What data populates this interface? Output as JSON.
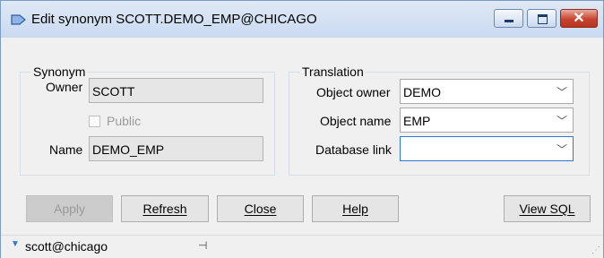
{
  "window": {
    "title": "Edit synonym SCOTT.DEMO_EMP@CHICAGO",
    "close_glyph": "✕",
    "icon": "synonym-arrow-icon",
    "accent_color": "#2a7ad6"
  },
  "synonym": {
    "legend": "Synonym",
    "owner_label": "Owner",
    "owner_value": "SCOTT",
    "public_label": "Public",
    "public_checked": false,
    "name_label": "Name",
    "name_value": "DEMO_EMP"
  },
  "translation": {
    "legend": "Translation",
    "object_owner_label": "Object owner",
    "object_owner_value": "DEMO",
    "object_name_label": "Object name",
    "object_name_value": "EMP",
    "database_link_label": "Database link",
    "database_link_value": ""
  },
  "buttons": {
    "apply": "Apply",
    "refresh": "Refresh",
    "close": "Close",
    "help": "Help",
    "view_sql": "View SQL"
  },
  "status": {
    "connection": "scott@chicago"
  },
  "glyphs": {
    "chevron": "﹀",
    "dropdown_arrow": "▼",
    "pin": "⊣",
    "grip": "⋰"
  }
}
